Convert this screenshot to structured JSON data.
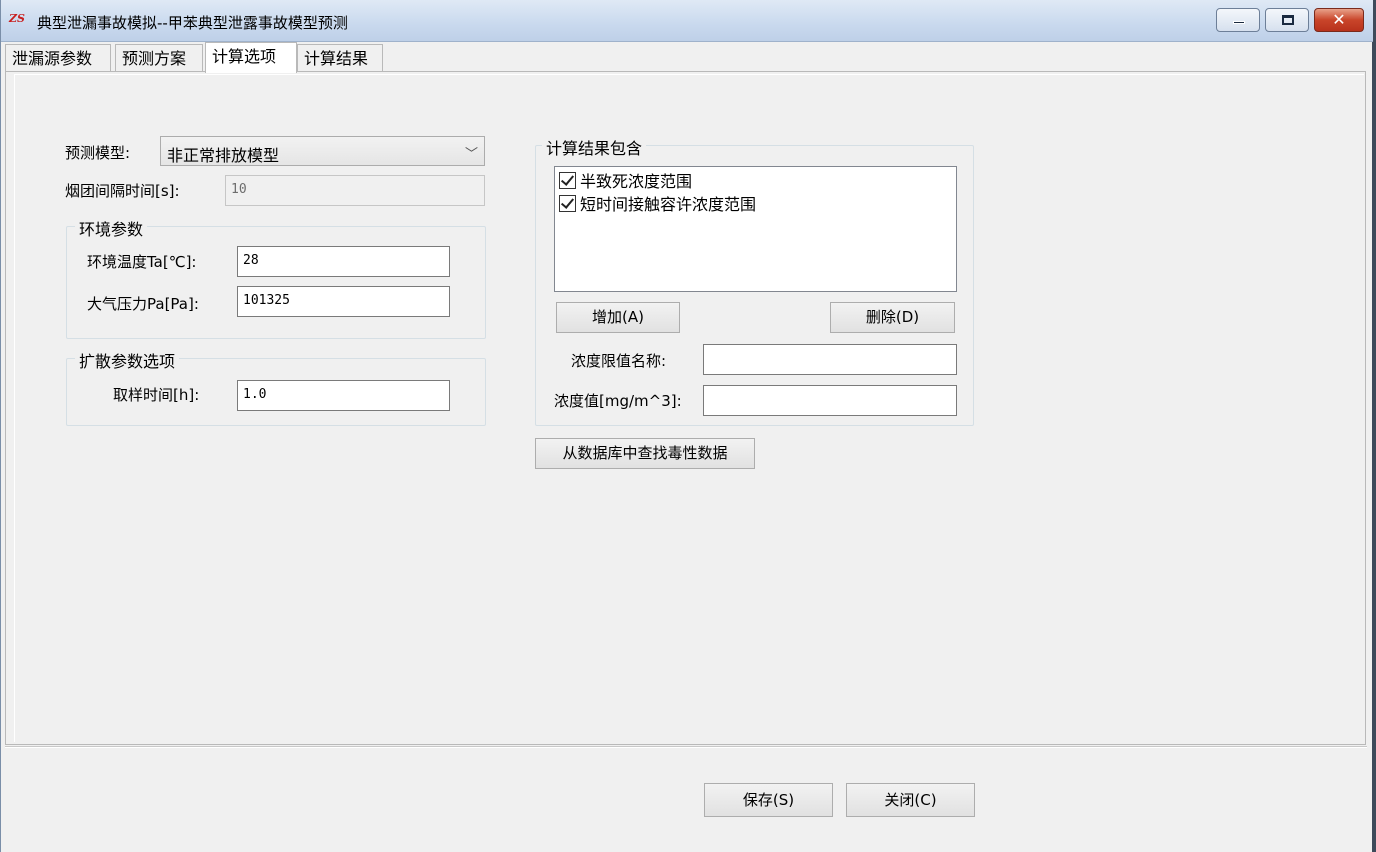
{
  "window": {
    "title": "典型泄漏事故模拟--甲苯典型泄露事故模型预测",
    "logo_text": "ZS",
    "controls": {
      "minimize": "minimize",
      "maximize": "maximize",
      "close": "✕"
    }
  },
  "tabs": [
    {
      "label": "泄漏源参数",
      "active": false
    },
    {
      "label": "预测方案",
      "active": false
    },
    {
      "label": "计算选项",
      "active": true
    },
    {
      "label": "计算结果",
      "active": false
    }
  ],
  "form": {
    "model_label": "预测模型:",
    "model_value": "非正常排放模型",
    "interval_label": "烟团间隔时间[s]:",
    "interval_value": "10",
    "env_group_title": "环境参数",
    "temp_label": "环境温度Ta[℃]:",
    "temp_value": "28",
    "pressure_label": "大气压力Pa[Pa]:",
    "pressure_value": "101325",
    "diffusion_group_title": "扩散参数选项",
    "sampling_label": "取样时间[h]:",
    "sampling_value": "1.0"
  },
  "results_group": {
    "title": "计算结果包含",
    "items": [
      {
        "label": "半致死浓度范围",
        "checked": true
      },
      {
        "label": "短时间接触容许浓度范围",
        "checked": true
      }
    ],
    "add_button": "增加(A)",
    "delete_button": "删除(D)",
    "limit_name_label": "浓度限值名称:",
    "limit_name_value": "",
    "conc_value_label": "浓度值[mg/m^3]:",
    "conc_value_value": ""
  },
  "db_button": "从数据库中查找毒性数据",
  "footer": {
    "save_button": "保存(S)",
    "close_button": "关闭(C)"
  }
}
